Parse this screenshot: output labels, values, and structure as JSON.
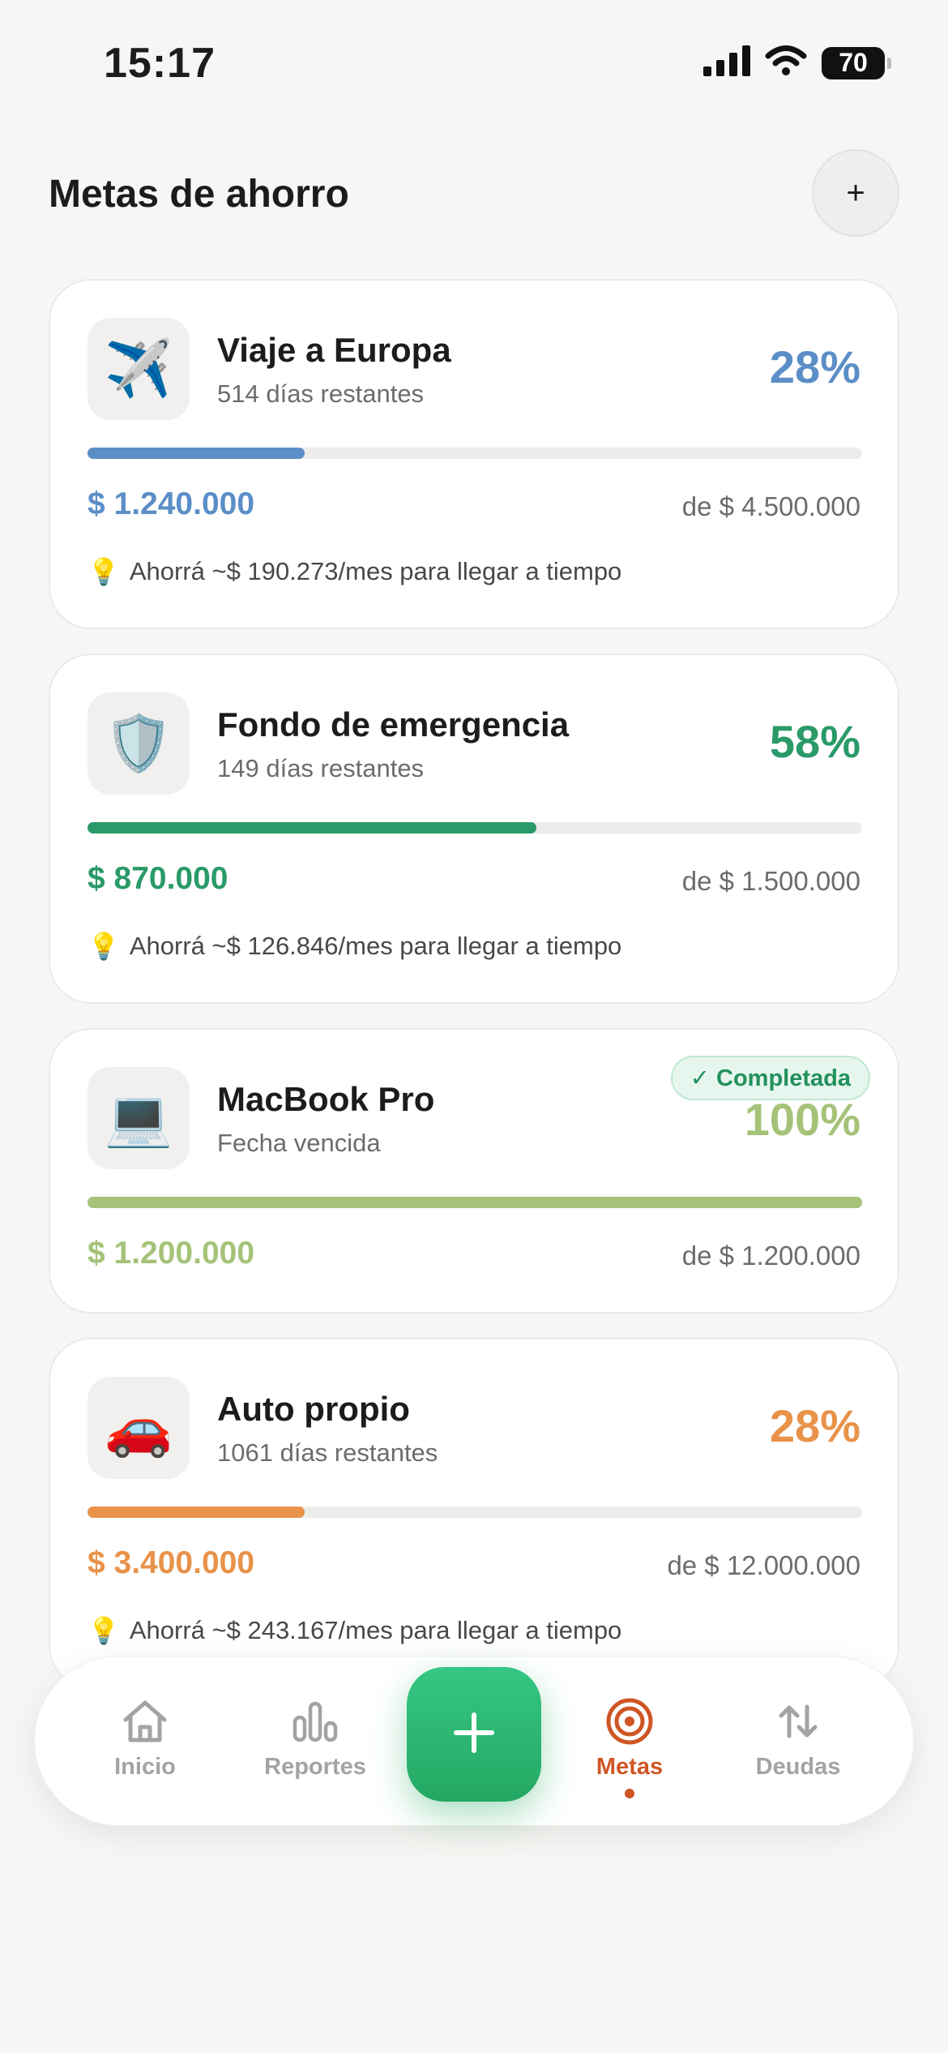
{
  "status_bar": {
    "time": "15:17",
    "battery": "70"
  },
  "header": {
    "title": "Metas de ahorro",
    "add_label": "+"
  },
  "goals": [
    {
      "icon": "✈️",
      "icon_name": "airplane-icon",
      "name": "Viaje a Europa",
      "subtitle": "514 días restantes",
      "percent": "28%",
      "progress": 0.28,
      "saved": "$ 1.240.000",
      "target": "de $ 4.500.000",
      "tip": "Ahorrá ~$ 190.273/mes para llegar a tiempo",
      "color": "#5b8ec7"
    },
    {
      "icon": "🛡️",
      "icon_name": "shield-icon",
      "name": "Fondo de emergencia",
      "subtitle": "149 días restantes",
      "percent": "58%",
      "progress": 0.58,
      "saved": "$ 870.000",
      "target": "de $ 1.500.000",
      "tip": "Ahorrá ~$ 126.846/mes para llegar a tiempo",
      "color": "#2a9a68"
    },
    {
      "icon": "💻",
      "icon_name": "laptop-icon",
      "name": "MacBook Pro",
      "subtitle": "Fecha vencida",
      "percent": "100%",
      "progress": 1.0,
      "saved": "$ 1.200.000",
      "target": "de $ 1.200.000",
      "badge": "✓ Completada",
      "color": "#a5c279"
    },
    {
      "icon": "🚗",
      "icon_name": "car-icon",
      "name": "Auto propio",
      "subtitle": "1061 días restantes",
      "percent": "28%",
      "progress": 0.28,
      "saved": "$ 3.400.000",
      "target": "de $ 12.000.000",
      "tip": "Ahorrá ~$ 243.167/mes para llegar a tiempo",
      "color": "#e8924a"
    }
  ],
  "tab_bar": {
    "items": [
      {
        "label": "Inicio",
        "icon": "home-icon"
      },
      {
        "label": "Reportes",
        "icon": "bar-chart-icon"
      },
      {
        "label": "Metas",
        "icon": "target-icon",
        "active": true
      },
      {
        "label": "Deudas",
        "icon": "transfer-arrows-icon"
      }
    ],
    "fab_icon": "plus-icon",
    "active_color": "#cf5524",
    "fab_color": "#2bb772"
  }
}
